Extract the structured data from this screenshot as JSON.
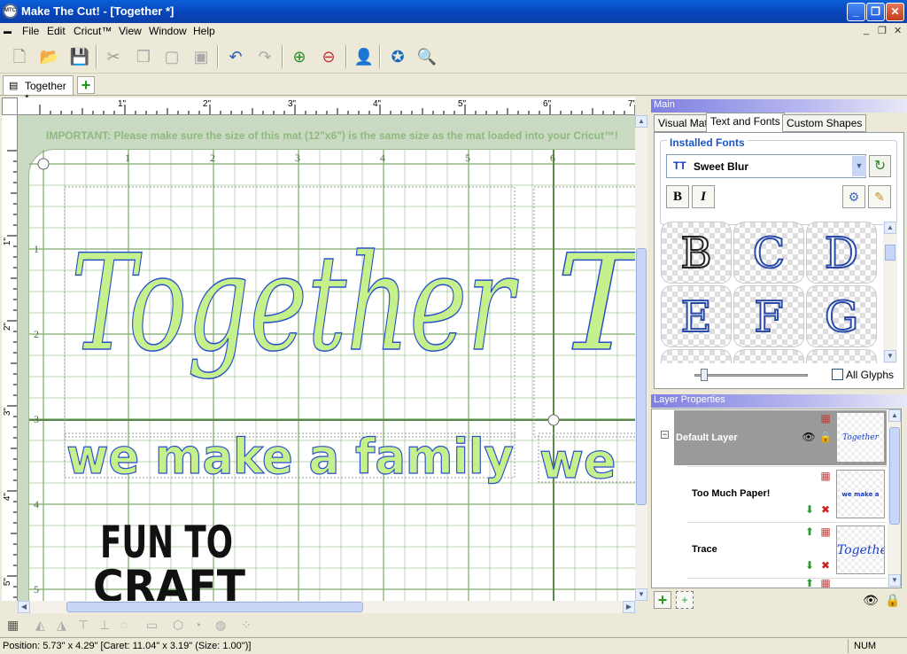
{
  "window": {
    "title": "Make The Cut! - [Together *]",
    "app_icon": "MTC",
    "minimize": "_",
    "maximize": "❐",
    "close": "✕"
  },
  "menu": [
    "File",
    "Edit",
    "Cricut™",
    "View",
    "Window",
    "Help"
  ],
  "mdi_controls": [
    "_",
    "❐",
    "✕"
  ],
  "toolbar_icons": [
    "new-file-icon",
    "open-file-icon",
    "save-icon",
    "cut-icon",
    "copy-icon",
    "paste-icon",
    "paste-in-place-icon",
    "undo-icon",
    "redo-icon",
    "zoom-in-icon",
    "zoom-out-icon",
    "user-info-icon",
    "cut-mat-icon",
    "search-icon"
  ],
  "doc_tab": {
    "label": "Together *",
    "add_label": "+"
  },
  "ruler": {
    "h": [
      "1\"",
      "2\"",
      "3\"",
      "4\"",
      "5\"",
      "6\"",
      "7\""
    ],
    "v": [
      "1\"",
      "2\"",
      "3\"",
      "4\"",
      "5\""
    ]
  },
  "mat": {
    "notice": "IMPORTANT: Please make sure the size of this mat (12\"x6\") is the same size as the mat loaded into your Cricut™!",
    "h_ticks": [
      "1",
      "2",
      "3",
      "4",
      "5",
      "6"
    ],
    "v_ticks": [
      "1",
      "2",
      "3",
      "4",
      "5"
    ]
  },
  "canvas_text": {
    "word1": "Together",
    "word2": "we make a family",
    "word1_repeat": "T",
    "word2_repeat": "we",
    "watermark_line1": "FUN TO",
    "watermark_line2": "CRAFT"
  },
  "colors": {
    "fill": "#c6f08c",
    "outline": "#2850c8",
    "title_blue": "#0a4fd0",
    "grid": "#7fa86e",
    "panel_head": "#8e8ee6"
  },
  "panel": {
    "main_head": "Main",
    "tabs": [
      "Visual Mat",
      "Text and Fonts",
      "Custom Shapes"
    ],
    "active_tab": "Text and Fonts",
    "installed_fonts": "Installed Fonts",
    "font_select": "Sweet Blur",
    "font_type_badge": "TT",
    "bold": "B",
    "italic": "I",
    "glyphs": [
      "B",
      "C",
      "D",
      "E",
      "F",
      "G"
    ],
    "all_glyphs": "All Glyphs"
  },
  "layers": {
    "head": "Layer Properties",
    "default_layer": "Default Layer",
    "items": [
      {
        "name": "Too Much Paper!",
        "thumb": "we make a family"
      },
      {
        "name": "Trace",
        "thumb": "Together"
      }
    ],
    "default_thumb": "Together Togethe",
    "collapse": "−"
  },
  "status": {
    "position": "Position: 5.73\" x 4.29\" [Caret: 11.04\" x 3.19\" (Size: 1.00\")]",
    "num": "NUM"
  }
}
